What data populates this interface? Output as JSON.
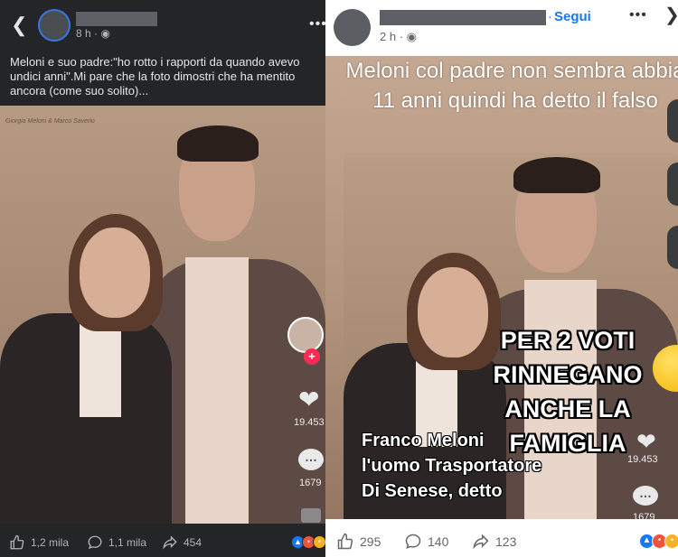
{
  "left_post": {
    "time": "8 h",
    "caption": "Meloni e suo padre:\"ho rotto i rapporti da quando avevo undici anni\".Mi pare che la foto dimostri che ha mentito ancora (come suo solito)...",
    "photo_header": "Giorgia Meloni & Marco Saverio",
    "tiktok_likes": "19.453",
    "tiktok_comments": "1679",
    "actions": {
      "likes": "1,2 mila",
      "comments": "1,1 mila",
      "shares": "454"
    }
  },
  "right_post": {
    "time": "2 h",
    "follow_label": "Segui",
    "dot": "·",
    "top_text": "Meloni col padre non sembra abbia 11 anni quindi ha detto il falso",
    "overlay_text": "PER 2 VOTI RINNEGANO ANCHE LA FAMIGLIA",
    "left_text": "Franco Meloni l'uomo Trasportatore Di Senese, detto",
    "tiktok_likes": "19.453",
    "tiktok_comments": "1679",
    "actions": {
      "likes": "295",
      "comments": "140",
      "shares": "123"
    }
  },
  "icons": {
    "back": "chevron-left-icon",
    "more": "more-horizontal-icon",
    "close": "chevron-right-icon",
    "globe": "globe-icon",
    "like": "thumbs-up-icon",
    "comment": "comment-bubble-icon",
    "share": "share-arrow-icon"
  },
  "colors": {
    "facebook_blue": "#1877f2",
    "dark_bg": "#242526",
    "like_reaction": "#1877f2",
    "angry_reaction": "#f0533c",
    "haha_reaction": "#f7b125"
  }
}
